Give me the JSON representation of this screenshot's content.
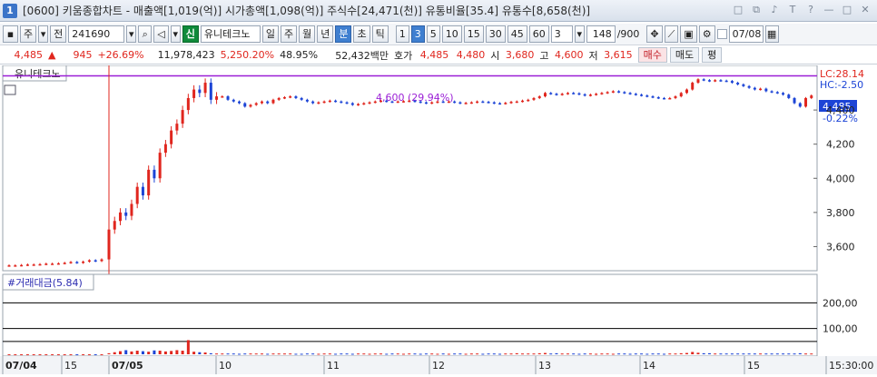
{
  "titlebar": {
    "window_number": "1",
    "title": "[0600] 키움종합차트 - 매출액[1,019(억)] 시가총액[1,098(억)] 주식수[24,471(천)] 유통비율[35.4] 유통수[8,658(천)]",
    "controls": [
      "□",
      "⧉",
      "♪",
      "T",
      "?",
      "—",
      "□",
      "✕"
    ]
  },
  "toolbar": {
    "market": "주",
    "prefix": "전",
    "code": "241690",
    "badge": "신",
    "stock_name": "유니테크노",
    "periods": [
      "일",
      "주",
      "월",
      "년",
      "분",
      "초",
      "틱"
    ],
    "period_active": "분",
    "intervals": [
      "1",
      "3",
      "5",
      "10",
      "15",
      "30",
      "45",
      "60"
    ],
    "interval_active": "3",
    "count_select": "3",
    "view_count": "148",
    "total_count": "/900",
    "date": "07/08"
  },
  "quote": {
    "price": "4,485",
    "change_arrow": "▲",
    "change": "945",
    "change_rate": "+26.69%",
    "volume": "11,978,423",
    "volume_rate": "5,250.20%",
    "turnover": "48.95%",
    "trade_value": "52,432백만",
    "hoga_label": "호가",
    "ask": "4,485",
    "bid": "4,480",
    "open_label": "시",
    "open": "3,680",
    "high_label": "고",
    "high": "4,600",
    "low_label": "저",
    "low": "3,615",
    "buy_label": "매수",
    "sell_label": "매도",
    "flat_label": "평"
  },
  "chart": {
    "price_pane_title": "유니테크노",
    "max_annotation": "4,600 (29.94%)",
    "lc_label": "LC:28.14",
    "hc_label": "HC:-2.50",
    "current_price_tag": "4,485",
    "current_change_tag": "-0.22%",
    "price_ticks": [
      "4,400",
      "4,200",
      "4,000",
      "3,800",
      "3,600"
    ],
    "volume_pane_title": "#거래대금(5.84)",
    "volume_ticks": [
      "200,00",
      "100,00"
    ],
    "x_labels": [
      "07/04",
      "15",
      "07/05",
      "10",
      "11",
      "12",
      "13",
      "14",
      "15",
      "15:30:00"
    ],
    "up_color": "#e0261e",
    "down_color": "#1c44d6",
    "max_line_color": "#9b1fd6"
  },
  "chart_data": {
    "type": "candlestick",
    "title": "유니테크노",
    "y_ticks": [
      3600,
      3800,
      4000,
      4200,
      4400
    ],
    "max_price": 4600,
    "current_price": 4485,
    "price_series": [
      3490,
      3490,
      3492,
      3495,
      3495,
      3497,
      3500,
      3500,
      3502,
      3505,
      3510,
      3505,
      3512,
      3520,
      3515,
      3525,
      3700,
      3750,
      3800,
      3780,
      3850,
      3950,
      3900,
      4050,
      4000,
      4150,
      4200,
      4280,
      4320,
      4400,
      4470,
      4520,
      4500,
      4560,
      4460,
      4480,
      4480,
      4460,
      4450,
      4440,
      4420,
      4430,
      4440,
      4450,
      4440,
      4460,
      4470,
      4475,
      4480,
      4470,
      4460,
      4450,
      4440,
      4445,
      4450,
      4455,
      4450,
      4445,
      4440,
      4430,
      4435,
      4440,
      4445,
      4450,
      4455,
      4450,
      4448,
      4450,
      4452,
      4455,
      4450,
      4445,
      4440,
      4445,
      4450,
      4448,
      4450,
      4445,
      4440,
      4442,
      4445,
      4450,
      4448,
      4445,
      4440,
      4438,
      4442,
      4448,
      4450,
      4455,
      4460,
      4470,
      4480,
      4500,
      4495,
      4490,
      4495,
      4500,
      4498,
      4492,
      4485,
      4490,
      4495,
      4500,
      4505,
      4510,
      4505,
      4500,
      4495,
      4490,
      4485,
      4480,
      4475,
      4470,
      4468,
      4470,
      4480,
      4500,
      4520,
      4560,
      4580,
      4575,
      4570,
      4575,
      4572,
      4570,
      4560,
      4550,
      4540,
      4530,
      4520,
      4525,
      4510,
      4505,
      4500,
      4490,
      4470,
      4440,
      4420,
      4470,
      4485
    ],
    "volume_series": [
      0.2,
      0.2,
      0.2,
      0.2,
      0.2,
      0.2,
      0.2,
      0.2,
      0.2,
      0.2,
      0.2,
      0.2,
      0.2,
      0.2,
      0.2,
      0.2,
      4,
      8,
      12,
      16,
      11,
      14,
      12,
      10,
      15,
      14,
      11,
      13,
      16,
      14,
      55,
      10,
      8,
      7,
      4,
      3,
      3,
      3,
      3,
      2,
      3,
      3,
      3,
      3,
      2,
      3,
      3,
      3,
      3,
      2,
      2,
      3,
      3,
      2,
      3,
      3,
      2,
      3,
      3,
      2,
      3,
      3,
      2,
      3,
      3,
      2,
      3,
      3,
      2,
      3,
      3,
      2,
      3,
      3,
      2,
      3,
      2,
      3,
      3,
      2,
      3,
      3,
      2,
      3,
      3,
      2,
      3,
      3,
      4,
      3,
      3,
      3,
      4,
      5,
      3,
      4,
      3,
      3,
      3,
      2,
      3,
      3,
      2,
      3,
      3,
      2,
      3,
      3,
      2,
      3,
      3,
      2,
      3,
      3,
      2,
      3,
      3,
      4,
      5,
      9,
      6,
      4,
      4,
      3,
      3,
      3,
      3,
      3,
      3,
      3,
      3,
      3,
      3,
      3,
      3,
      3,
      3,
      3,
      4,
      3,
      3
    ],
    "volume_y_ticks": [
      100,
      200
    ],
    "x_axis_labels": [
      "07/04",
      "15",
      "07/05",
      "10",
      "11",
      "12",
      "13",
      "14",
      "15",
      "15:30:00"
    ]
  }
}
